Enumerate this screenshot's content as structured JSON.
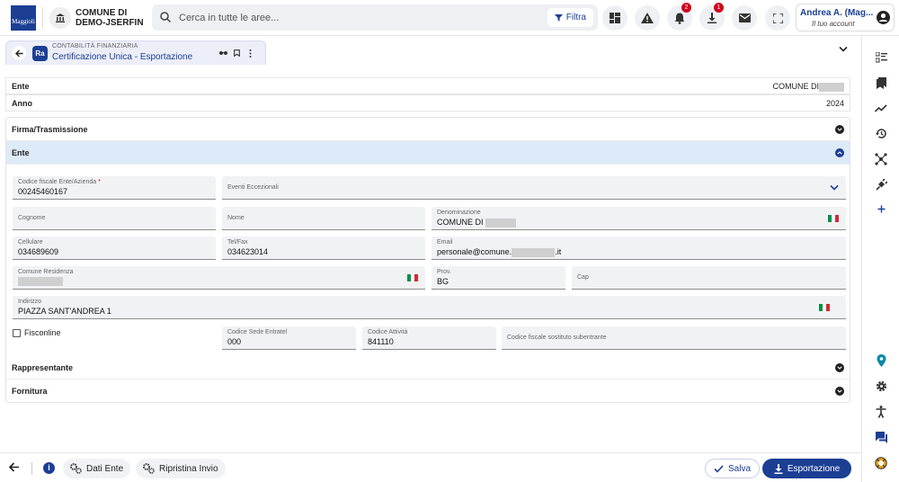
{
  "header": {
    "logo_text": "Maggioli",
    "ente_line1": "COMUNE DI",
    "ente_line2": "DEMO-JSERFIN",
    "search_placeholder": "Cerca in tutte le aree...",
    "filter_label": "Filtra",
    "notifications_count": "2",
    "downloads_count": "1",
    "user_name": "Andrea A. (Mag...",
    "user_sub": "Il tuo account"
  },
  "tab": {
    "category": "CONTABILITÀ FINANZIARIA",
    "title": "Certificazione Unica - Esportazione",
    "app_badge": "Ra"
  },
  "summary": {
    "ente_label": "Ente",
    "ente_value": "COMUNE DI",
    "anno_label": "Anno",
    "anno_value": "2024"
  },
  "sections": {
    "firma": "Firma/Trasmissione",
    "ente": "Ente",
    "rappresentante": "Rappresentante",
    "fornitura": "Fornitura"
  },
  "fields": {
    "codice_fiscale": {
      "label": "Codice fiscale Ente/Azienda",
      "value": "00245460167"
    },
    "eventi": {
      "label": "Eventi Eccezionali",
      "value": ""
    },
    "cognome": {
      "label": "Cognome",
      "value": ""
    },
    "nome": {
      "label": "Nome",
      "value": ""
    },
    "denominazione": {
      "label": "Denominazione",
      "value": "COMUNE DI"
    },
    "cellulare": {
      "label": "Cellulare",
      "value": "034689609"
    },
    "telfax": {
      "label": "Tel/Fax",
      "value": "034623014"
    },
    "email": {
      "label": "Email",
      "value_prefix": "personale@comune.",
      "value_suffix": ".it"
    },
    "comune_residenza": {
      "label": "Comune Residenza",
      "value": ""
    },
    "prov": {
      "label": "Prov.",
      "value": "BG"
    },
    "cap": {
      "label": "Cap",
      "value": ""
    },
    "indirizzo": {
      "label": "Indirizzo",
      "value": "PIAZZA SANT'ANDREA 1"
    },
    "fisconline": {
      "label": "Fisconline"
    },
    "codice_sede": {
      "label": "Codice Sede Entratel",
      "value": "000"
    },
    "codice_attivita": {
      "label": "Codice Attività",
      "value": "841110"
    },
    "cf_sostituto": {
      "label": "Codice fiscale sostituto subentrante",
      "value": ""
    }
  },
  "footer": {
    "dati_ente": "Dati Ente",
    "ripristina": "Ripristina Invio",
    "salva": "Salva",
    "esportazione": "Esportazione"
  },
  "colors": {
    "primary": "#1c3f94",
    "section_open_bg": "#ddeaf8",
    "badge": "#d0021b",
    "flag_green": "#009246",
    "flag_red": "#ce2b37"
  }
}
